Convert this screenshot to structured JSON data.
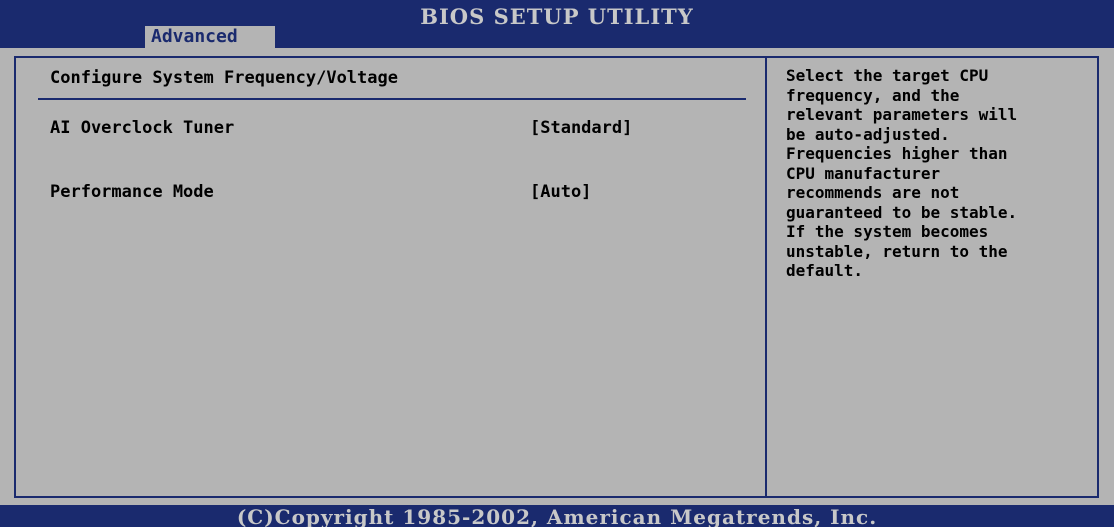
{
  "header": {
    "title": "BIOS SETUP UTILITY",
    "active_tab": "Advanced"
  },
  "main": {
    "section_title": "Configure System Frequency/Voltage",
    "settings": [
      {
        "label": "AI Overclock Tuner",
        "value": "[Standard]"
      },
      {
        "label": "Performance Mode",
        "value": "[Auto]"
      }
    ]
  },
  "help": {
    "text": "Select the target CPU\nfrequency, and the\nrelevant parameters will\nbe auto-adjusted.\nFrequencies higher than\nCPU manufacturer\nrecommends are not\nguaranteed to be stable.\nIf the system becomes\nunstable, return to the\ndefault."
  },
  "footer": {
    "copyright": "(C)Copyright 1985-2002, American Megatrends, Inc."
  },
  "colors": {
    "bar": "#1a2a6e",
    "panel": "#b4b4b4",
    "bar_text": "#c8c8c8"
  }
}
